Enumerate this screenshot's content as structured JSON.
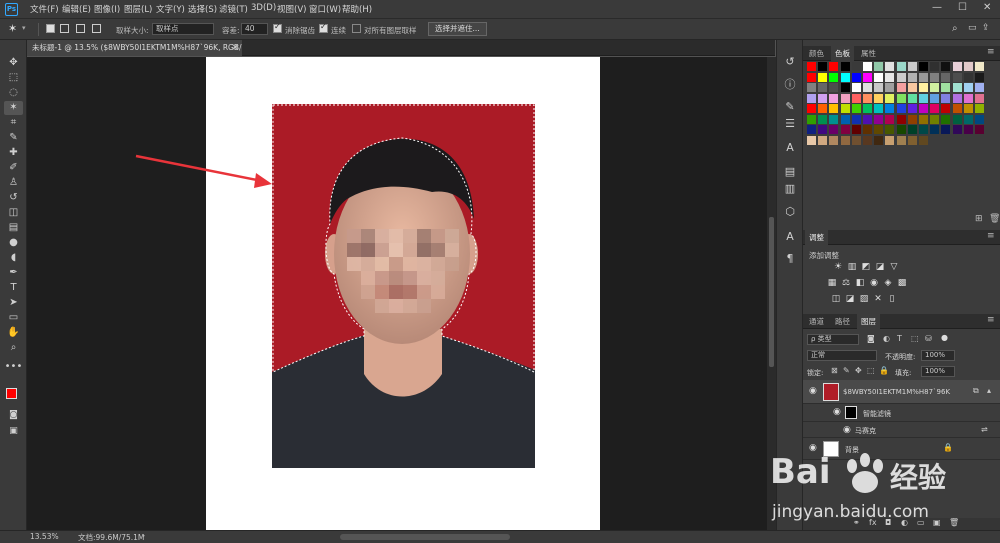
{
  "app": {
    "logo": "Ps"
  },
  "menu": {
    "items": [
      "文件(F)",
      "编辑(E)",
      "图像(I)",
      "图层(L)",
      "文字(Y)",
      "选择(S)",
      "滤镜(T)",
      "3D(D)",
      "视图(V)",
      "窗口(W)",
      "帮助(H)"
    ],
    "window_controls": [
      "—",
      "☐",
      "✕"
    ]
  },
  "options": {
    "sample_size_label": "取样大小:",
    "sample_size_value": "取样点",
    "tolerance_label": "容差:",
    "tolerance_value": "40",
    "anti_alias_label": "消除锯齿",
    "contiguous_label": "连续",
    "sample_all_label": "对所有图层取样",
    "select_mask_button": "选择并遮住..."
  },
  "document": {
    "tab_title": "未标题-1 @ 13.5% ($8WBY50I1EKTM1M%H87`96K, RGB/8) *",
    "close": "×"
  },
  "status": {
    "zoom": "13.53%",
    "doc_info": "文档:99.6M/75.1M"
  },
  "swatches_panel": {
    "tabs": [
      "颜色",
      "色板",
      "属性"
    ],
    "active_tab": "色板",
    "colors": [
      [
        "#ff0000",
        "#000000",
        "#ff0000",
        "#000000",
        "#3a3a3a",
        "#ffffff",
        "#90c8a8",
        "#e0e0e0",
        "#9ad6c8",
        "#c8c8c8",
        "#000000",
        "#303030",
        "#101010",
        "#e8d0d8",
        "#e0c8c8",
        "#f0e8c8"
      ],
      [
        "#ff0000",
        "#ffff00",
        "#00ff00",
        "#00ffff",
        "#0000ff",
        "#ff00ff",
        "#ffffff",
        "#e6e6e6",
        "#cccccc",
        "#b3b3b3",
        "#999999",
        "#808080",
        "#666666",
        "#4d4d4d",
        "#333333",
        "#1a1a1a"
      ],
      [
        "#808080",
        "#666666",
        "#4d4d4d",
        "#000000",
        "#ffffff",
        "#e0e0e0",
        "#c8c8c8",
        "#a0a0a0",
        "#f4a0a0",
        "#f8c8a0",
        "#fff0a0",
        "#d0f0a0",
        "#a0e0a0",
        "#a0e0d0",
        "#a0d0f0",
        "#a0b0f0"
      ],
      [
        "#b0a0f0",
        "#d0a0f0",
        "#f0a0e0",
        "#f0a0c0",
        "#ff6060",
        "#ff9060",
        "#ffd060",
        "#e0f060",
        "#80e060",
        "#60e0a0",
        "#60d0e0",
        "#60a0e0",
        "#8080e0",
        "#b070e0",
        "#e070d0",
        "#e07090"
      ],
      [
        "#ff0000",
        "#ff6000",
        "#ffc000",
        "#c0e000",
        "#40d000",
        "#00c060",
        "#00c0c0",
        "#0080e0",
        "#2040e0",
        "#6020e0",
        "#c000c0",
        "#e00060",
        "#c00000",
        "#c05000",
        "#c09000",
        "#90b000"
      ],
      [
        "#30a000",
        "#009050",
        "#009090",
        "#0060b0",
        "#1030b0",
        "#5010b0",
        "#900090",
        "#b00050",
        "#900000",
        "#904000",
        "#907000",
        "#708000",
        "#207000",
        "#006040",
        "#006868",
        "#004880"
      ],
      [
        "#102080",
        "#400880",
        "#680068",
        "#800040",
        "#600000",
        "#603000",
        "#604800",
        "#485800",
        "#184800",
        "#004028",
        "#004848",
        "#003058",
        "#081858",
        "#300858",
        "#480048",
        "#580030"
      ],
      [
        "#e8c8a8",
        "#d0a880",
        "#b08860",
        "#906840",
        "#705030",
        "#583820",
        "#402810",
        "#c8a070",
        "#a08050",
        "#806030",
        "#604820"
      ]
    ]
  },
  "adjustments_panel": {
    "tab": "调整",
    "title": "添加调整",
    "row1": [
      "☀",
      "▥",
      "◩",
      "◪",
      "▽"
    ],
    "row2": [
      "▦",
      "⚖",
      "◧",
      "◉",
      "◈",
      "▩"
    ],
    "row3": [
      "◫",
      "◪",
      "▨",
      "✕",
      "▯"
    ]
  },
  "layers_panel": {
    "tabs": [
      "通道",
      "路径",
      "图层"
    ],
    "active_tab": "图层",
    "kind_filter": "ρ 类型",
    "filter_icons": [
      "◙",
      "◐",
      "T",
      "⬚",
      "⛁"
    ],
    "blend_mode": "正常",
    "opacity_label": "不透明度:",
    "opacity_value": "100%",
    "lock_label": "锁定:",
    "fill_label": "填充:",
    "fill_value": "100%",
    "layers": [
      {
        "name": "$8WBY50I1EKTM1M%H87`96K",
        "type": "smart-object"
      },
      {
        "name": "智能滤镜",
        "type": "smart-filter"
      },
      {
        "name": "马赛克",
        "type": "filter"
      },
      {
        "name": "背景",
        "type": "background"
      }
    ],
    "footer_icons": [
      "⚭",
      "fx",
      "◘",
      "◐",
      "▭",
      "▣",
      "🗑"
    ]
  },
  "watermark": {
    "brand_left": "Bai",
    "brand_right": "经验",
    "url": "jingyan.baidu.com"
  },
  "colors": {
    "foreground": "#ff0000",
    "background": "#ffffff",
    "photo_bg": "#b01d28",
    "arrow": "#e8343a"
  }
}
